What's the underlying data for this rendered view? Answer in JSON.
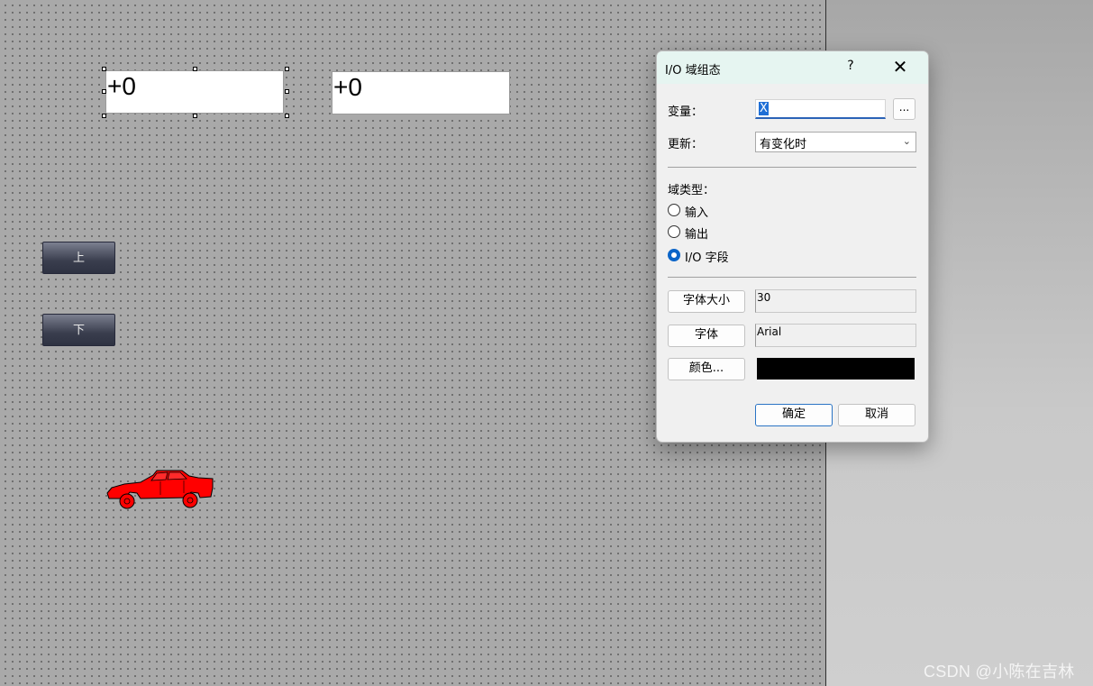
{
  "canvas": {
    "io_field_1_value": "+0",
    "io_field_2_value": "+0",
    "button_up_label": "上",
    "button_down_label": "下",
    "car_color": "#ff0000"
  },
  "dialog": {
    "title": "I/O 域组态",
    "help_label": "?",
    "close_label": "✕",
    "variable_label": "变量：",
    "variable_value": "X",
    "browse_label": "...",
    "update_label": "更新：",
    "update_value": "有变化时",
    "field_type_label": "域类型：",
    "radio_options": [
      {
        "label": "输入",
        "checked": false
      },
      {
        "label": "输出",
        "checked": false
      },
      {
        "label": "I/O 字段",
        "checked": true
      }
    ],
    "font_size_button": "字体大小",
    "font_size_value": "30",
    "font_button": "字体",
    "font_value": "Arial",
    "color_button": "颜色...",
    "color_value": "#000000",
    "ok_label": "确定",
    "cancel_label": "取消"
  },
  "watermark": "CSDN @小陈在吉林"
}
